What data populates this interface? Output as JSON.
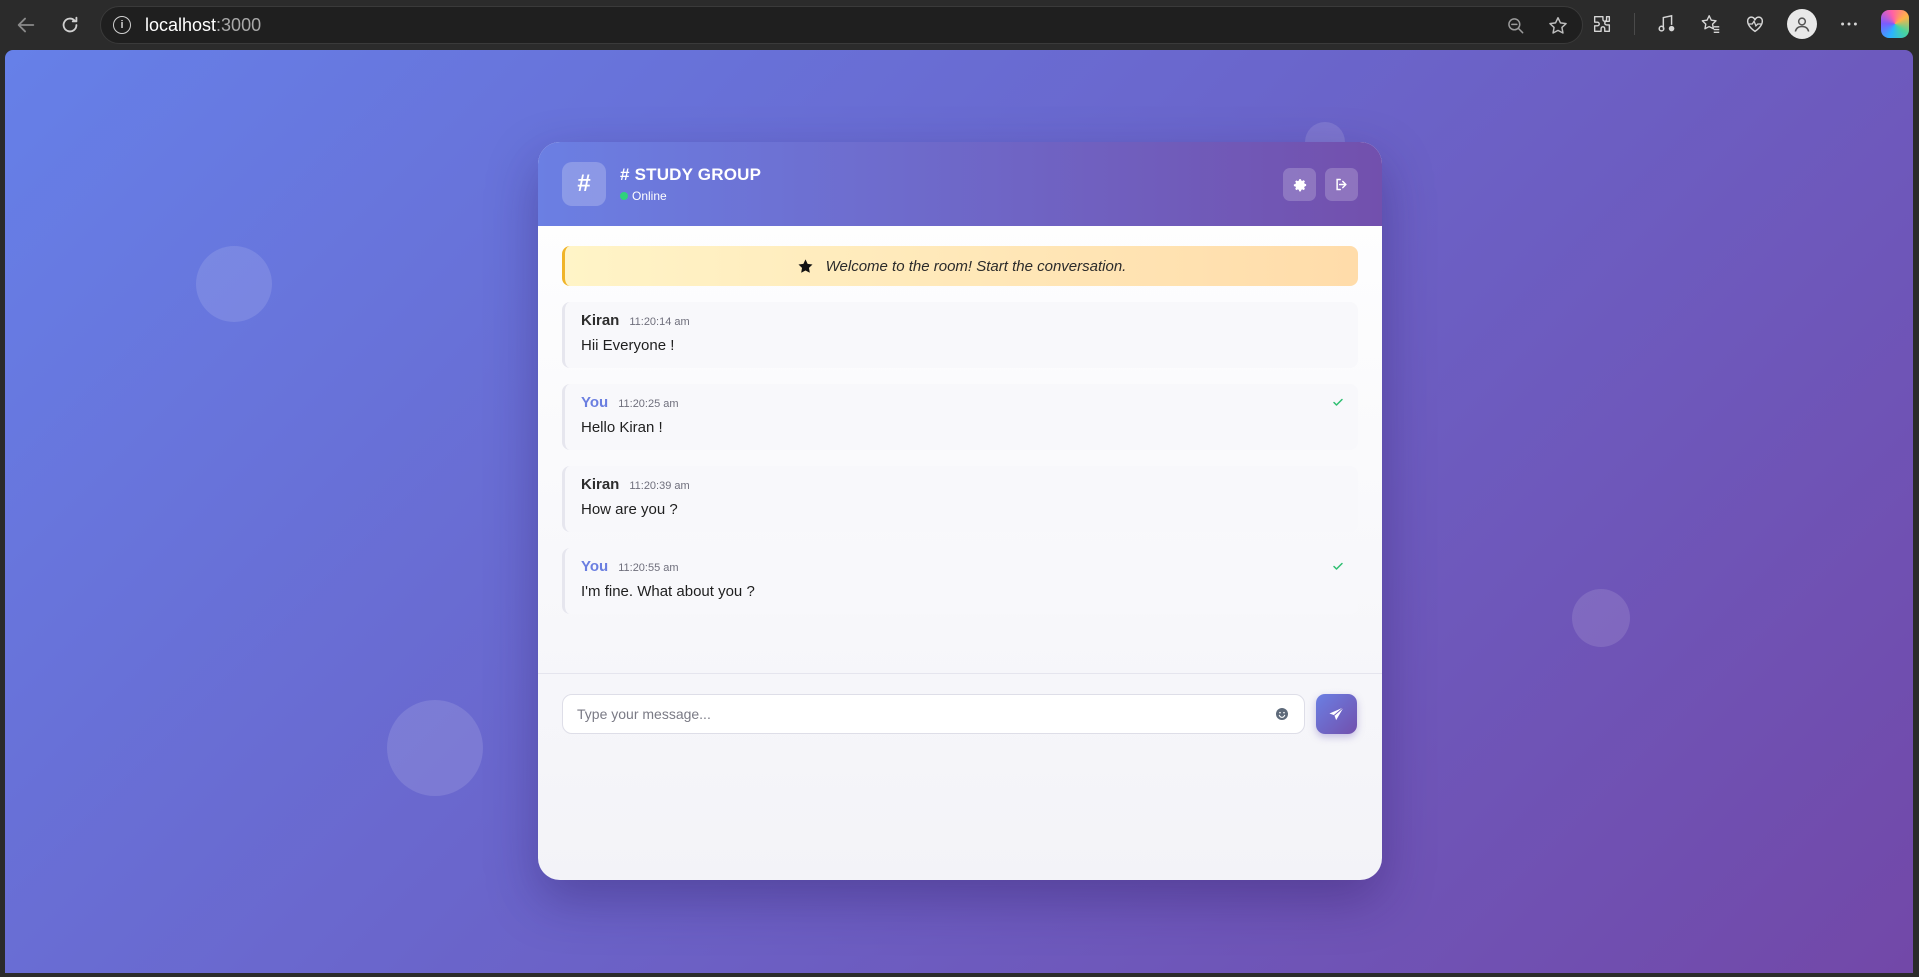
{
  "browser": {
    "url_host": "localhost",
    "url_port": ":3000",
    "icons": [
      "back-arrow-icon",
      "reload-icon",
      "site-info-icon",
      "zoom-out-icon",
      "favorite-star-icon",
      "extensions-icon",
      "media-icon",
      "favorites-icon",
      "health-icon",
      "profile-icon",
      "more-icon",
      "copilot-icon"
    ]
  },
  "room": {
    "icon_glyph": "#",
    "title": "# STUDY GROUP",
    "status": "Online",
    "status_color": "#2fd37c"
  },
  "welcome": {
    "text": "Welcome to the room! Start the conversation."
  },
  "messages": [
    {
      "author": "Kiran",
      "time": "11:20:14 am",
      "text": "Hii Everyone !",
      "own": false
    },
    {
      "author": "You",
      "time": "11:20:25 am",
      "text": "Hello Kiran !",
      "own": true
    },
    {
      "author": "Kiran",
      "time": "11:20:39 am",
      "text": "How are you ?",
      "own": false
    },
    {
      "author": "You",
      "time": "11:20:55 am",
      "text": "I'm fine. What about you ?",
      "own": true
    }
  ],
  "composer": {
    "placeholder": "Type your message..."
  },
  "colors": {
    "accent_start": "#6b7fe3",
    "accent_end": "#7250ad",
    "own_author": "#6a7ee0",
    "check": "#2fbf71"
  }
}
